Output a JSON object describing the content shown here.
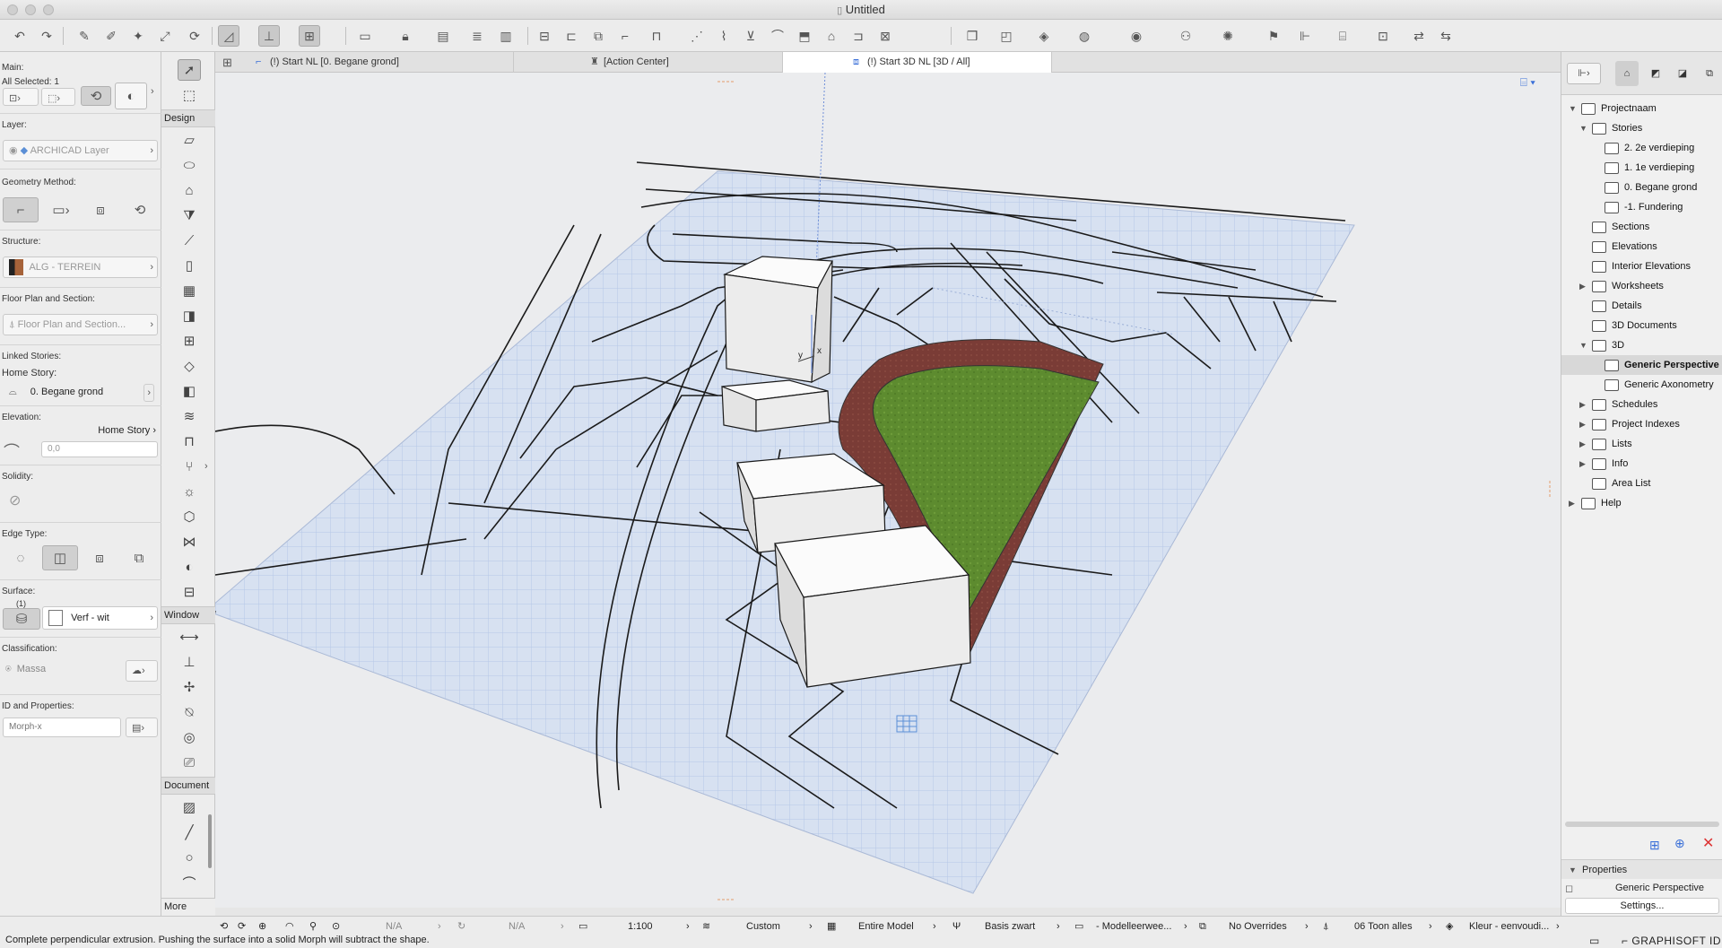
{
  "window": {
    "title": "Untitled"
  },
  "toolbar": {
    "buttons": [
      "undo-icon",
      "redo-icon",
      "eyedropper-icon",
      "syringe-icon",
      "magic-wand-icon",
      "rotate-icon"
    ]
  },
  "info_box": {
    "main_label": "Main:",
    "selected_label": "All Selected: 1",
    "layer_label": "Layer:",
    "layer_value": "ARCHICAD Layer",
    "geometry_label": "Geometry Method:",
    "structure_label": "Structure:",
    "structure_value": "ALG - TERREIN",
    "floorplan_label": "Floor Plan and Section:",
    "floorplan_value": "Floor Plan and Section...",
    "linked_label": "Linked Stories:",
    "home_story_label": "Home Story:",
    "home_story_value": "0. Begane grond",
    "elevation_label": "Elevation:",
    "elevation_ref": "Home Story",
    "elevation_value": "0,0",
    "solidity_label": "Solidity:",
    "edge_label": "Edge Type:",
    "surface_label": "Surface:",
    "surface_count": "(1)",
    "surface_value": "Verf - wit",
    "classification_label": "Classification:",
    "classification_value": "Massa",
    "id_label": "ID and Properties:",
    "id_value": "Morph-x"
  },
  "toolbox": {
    "design_label": "Design",
    "window_label": "Window",
    "document_label": "Document",
    "more_label": "More"
  },
  "tabs": [
    {
      "label": "(!) Start NL [0. Begane grond]"
    },
    {
      "label": "[Action Center]"
    },
    {
      "label": "(!) Start 3D NL [3D / All]"
    }
  ],
  "navigator": {
    "items": [
      {
        "label": "Projectnaam"
      },
      {
        "label": "Stories"
      },
      {
        "label": "2. 2e verdieping"
      },
      {
        "label": "1. 1e verdieping"
      },
      {
        "label": "0. Begane grond"
      },
      {
        "label": "-1. Fundering"
      },
      {
        "label": "Sections"
      },
      {
        "label": "Elevations"
      },
      {
        "label": "Interior Elevations"
      },
      {
        "label": "Worksheets"
      },
      {
        "label": "Details"
      },
      {
        "label": "3D Documents"
      },
      {
        "label": "3D"
      },
      {
        "label": "Generic Perspective"
      },
      {
        "label": "Generic Axonometry"
      },
      {
        "label": "Schedules"
      },
      {
        "label": "Project Indexes"
      },
      {
        "label": "Lists"
      },
      {
        "label": "Info"
      },
      {
        "label": "Area List"
      },
      {
        "label": "Help"
      }
    ],
    "properties_label": "Properties",
    "properties_value": "Generic Perspective",
    "settings_label": "Settings..."
  },
  "statusbar": {
    "na1": "N/A",
    "na2": "N/A",
    "scale": "1:100",
    "layer_combo": "Custom",
    "model_view": "Entire Model",
    "pen_set": "Basis zwart",
    "model_view_options": "- Modelleerwee...",
    "overrides": "No Overrides",
    "renovation": "06 Toon alles",
    "color": "Kleur - eenvoudi...",
    "message": "Complete perpendicular extrusion. Pushing the surface into a solid Morph will subtract the shape.",
    "brand": "GRAPHISOFT ID"
  },
  "colors": {
    "accent": "#3a6fd8",
    "grass": "#5a8a2e",
    "brick": "#7a3a34",
    "grid": "#c5d4ea"
  }
}
